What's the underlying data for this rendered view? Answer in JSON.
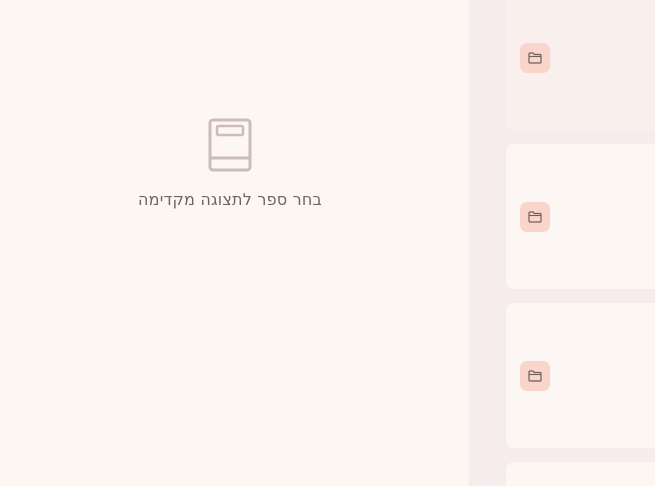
{
  "preview": {
    "icon": "book-icon",
    "empty_message": "בחר ספר לתצוגה מקדימה"
  },
  "side_panel": {
    "cards": [
      {
        "icon": "folder-icon"
      },
      {
        "icon": "folder-icon"
      },
      {
        "icon": "folder-icon"
      },
      {
        "icon": "folder-icon"
      }
    ]
  },
  "colors": {
    "background": "#fdf7f4",
    "side_panel": "#f6eceb",
    "icon_badge": "#fad5cc",
    "text": "#6f6463"
  }
}
